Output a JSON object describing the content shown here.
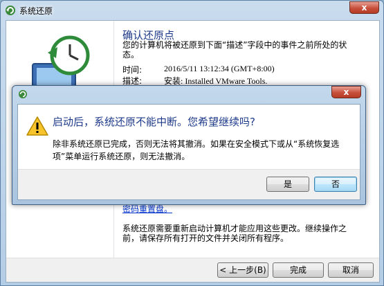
{
  "window": {
    "title": "系统还原",
    "close_glyph": "x"
  },
  "wizard": {
    "heading": "确认还原点",
    "description": "您的计算机将被还原到下面“描述”字段中的事件之前所处的状态。",
    "time_label": "时间:",
    "time_value": "2016/5/11 13:12:34 (GMT+8:00)",
    "desc_label": "描述:",
    "desc_value": "安装: Installed VMware Tools.",
    "link_fragment": "密码重置盘。",
    "restart_note": "系统还原需要重新启动计算机才能应用这些更改。继续操作之前，请保存所有打开的文件并关闭所有程序。",
    "buttons": {
      "back": "< 上一步(B)",
      "finish": "完成",
      "cancel": "取消"
    }
  },
  "dialog": {
    "heading": "启动后，系统还原不能中断。您希望继续吗?",
    "message": "除非系统还原已完成，否则无法将其撤消。如果在安全模式下或从“系统恢复选项”菜单运行系统还原，则无法撤消。",
    "yes": "是",
    "no": "否",
    "close_glyph": "x"
  },
  "colors": {
    "heading_blue": "#1e3a8a",
    "link_blue": "#0033cc",
    "close_red": "#c7503c",
    "title_gradient": "#b4cde6"
  },
  "icons": [
    "system-restore-icon",
    "restore-clock-monitor-icon",
    "warning-icon"
  ]
}
